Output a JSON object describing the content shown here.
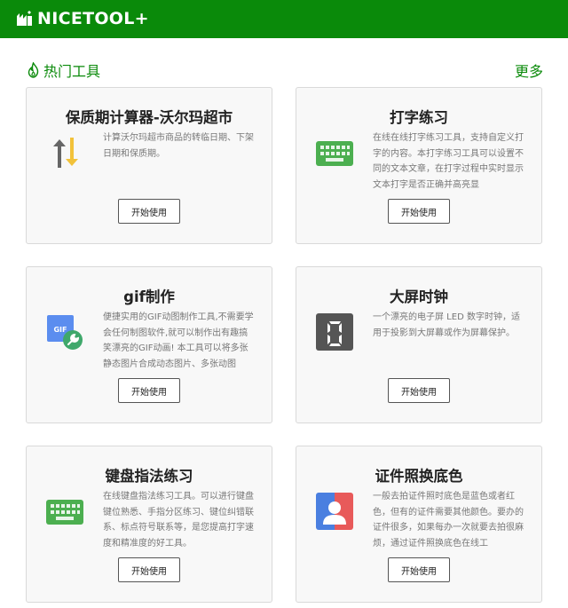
{
  "header": {
    "brand": "NICETOOL+",
    "brand_color": "#0a8a0a"
  },
  "section": {
    "title": "热门工具",
    "icon": "flame-icon",
    "more_label": "更多"
  },
  "cards": [
    {
      "title": "保质期计算器-沃尔玛超市",
      "icon": "sort-arrows-icon",
      "description": "计算沃尔玛超市商品的转临日期、下架日期和保质期。",
      "button_label": "开始使用"
    },
    {
      "title": "打字练习",
      "icon": "keyboard-icon",
      "description": "在线在线打字练习工具，支持自定义打字的内容。本打字练习工具可以设置不同的文本文章，在打字过程中实时显示文本打字是否正确并高亮显",
      "button_label": "开始使用"
    },
    {
      "title": "gif制作",
      "icon": "gif-tool-icon",
      "icon_text": "GIF",
      "description": "便捷实用的GIF动图制作工具,不需要学会任何制图软件,就可以制作出有趣搞笑漂亮的GIF动画! 本工具可以将多张静态图片合成动态图片、多张动图",
      "button_label": "开始使用"
    },
    {
      "title": "大屏时钟",
      "icon": "led-digit-icon",
      "icon_text": "8",
      "description": "一个漂亮的电子屏 LED 数字时钟，适用于投影到大屏幕或作为屏幕保护。",
      "button_label": "开始使用"
    },
    {
      "title": "键盘指法练习",
      "icon": "keyboard-icon",
      "description": "在线键盘指法练习工具。可以进行键盘键位熟悉、手指分区练习、键位纠错联系、标点符号联系等，是您提高打字速度和精准度的好工具。",
      "button_label": "开始使用"
    },
    {
      "title": "证件照换底色",
      "icon": "id-photo-icon",
      "description": "一般去拍证件照时底色是蓝色或者红色，但有的证件需要其他颜色。要办的证件很多，如果每办一次就要去拍很麻烦，通过证件照换底色在线工",
      "button_label": "开始使用"
    }
  ]
}
